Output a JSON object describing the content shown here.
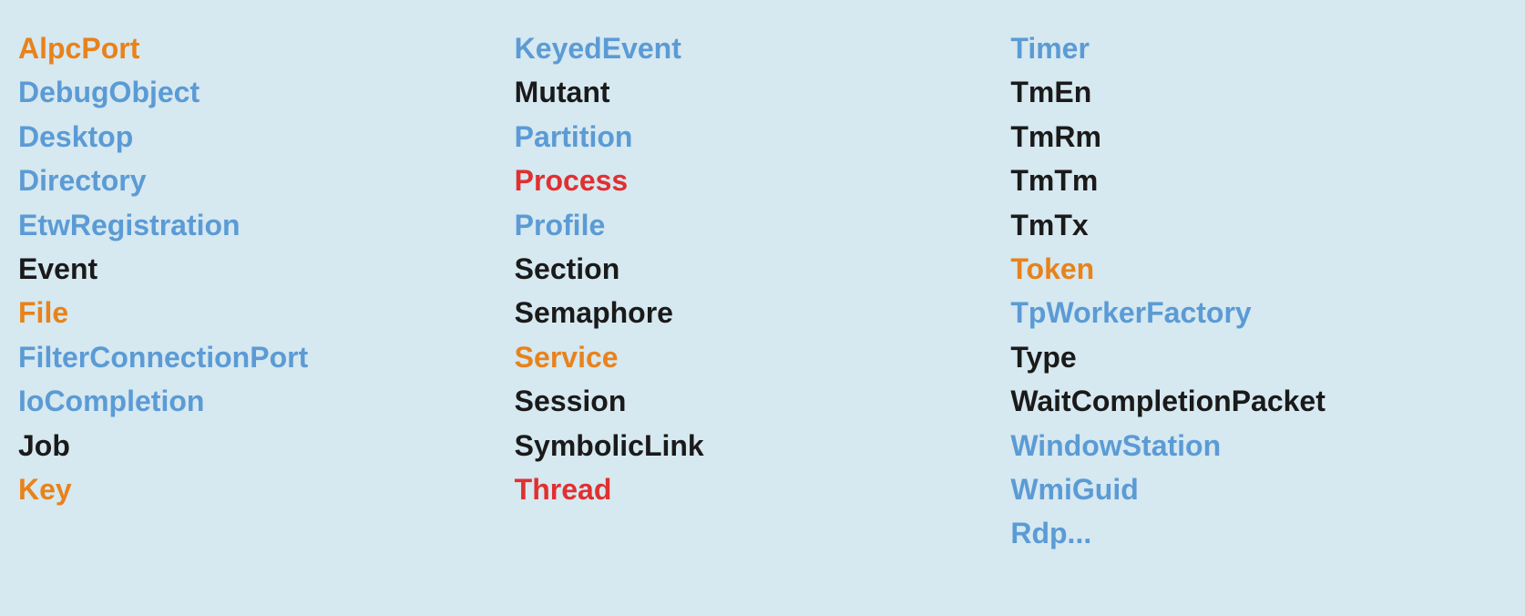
{
  "columns": [
    {
      "id": "col1",
      "items": [
        {
          "label": "AlpcPort",
          "color": "orange"
        },
        {
          "label": "DebugObject",
          "color": "blue"
        },
        {
          "label": "Desktop",
          "color": "blue"
        },
        {
          "label": "Directory",
          "color": "blue"
        },
        {
          "label": "EtwRegistration",
          "color": "blue"
        },
        {
          "label": "Event",
          "color": "black"
        },
        {
          "label": "File",
          "color": "orange"
        },
        {
          "label": "FilterConnectionPort",
          "color": "blue"
        },
        {
          "label": "IoCompletion",
          "color": "blue"
        },
        {
          "label": "Job",
          "color": "black"
        },
        {
          "label": "Key",
          "color": "orange"
        }
      ]
    },
    {
      "id": "col2",
      "items": [
        {
          "label": "KeyedEvent",
          "color": "blue"
        },
        {
          "label": "Mutant",
          "color": "black"
        },
        {
          "label": "Partition",
          "color": "blue"
        },
        {
          "label": "Process",
          "color": "red"
        },
        {
          "label": "Profile",
          "color": "blue"
        },
        {
          "label": "Section",
          "color": "black"
        },
        {
          "label": "Semaphore",
          "color": "black"
        },
        {
          "label": "Service",
          "color": "orange"
        },
        {
          "label": "Session",
          "color": "black"
        },
        {
          "label": "SymbolicLink",
          "color": "black"
        },
        {
          "label": "Thread",
          "color": "red"
        }
      ]
    },
    {
      "id": "col3",
      "items": [
        {
          "label": "Timer",
          "color": "blue"
        },
        {
          "label": "TmEn",
          "color": "black"
        },
        {
          "label": "TmRm",
          "color": "black"
        },
        {
          "label": "TmTm",
          "color": "black"
        },
        {
          "label": "TmTx",
          "color": "black"
        },
        {
          "label": "Token",
          "color": "orange"
        },
        {
          "label": "TpWorkerFactory",
          "color": "blue"
        },
        {
          "label": "Type",
          "color": "black"
        },
        {
          "label": "WaitCompletionPacket",
          "color": "black"
        },
        {
          "label": "WindowStation",
          "color": "blue"
        },
        {
          "label": "WmiGuid",
          "color": "blue"
        },
        {
          "label": "Rdp...",
          "color": "blue"
        }
      ]
    }
  ],
  "colorMap": {
    "orange": "#e8821a",
    "blue": "#5b9bd5",
    "black": "#1a1a1a",
    "red": "#e03030"
  }
}
